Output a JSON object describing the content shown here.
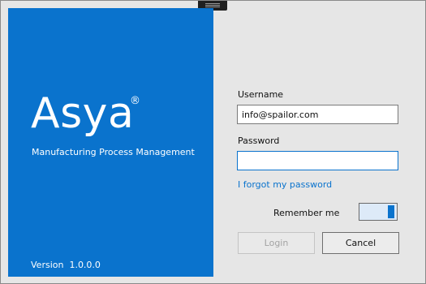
{
  "brand": {
    "logo_text": "Asya",
    "registered_mark": "®",
    "tagline": "Manufacturing Process Management",
    "version": "Version  1.0.0.0"
  },
  "login": {
    "username_label": "Username",
    "username_value": "info@spailor.com",
    "password_label": "Password",
    "password_value": "",
    "forgot_link": "I forgot my password",
    "remember_label": "Remember me",
    "remember_on": true,
    "login_button": "Login",
    "cancel_button": "Cancel"
  },
  "colors": {
    "brand_blue": "#0a73cd",
    "window_bg": "#e6e6e6"
  }
}
